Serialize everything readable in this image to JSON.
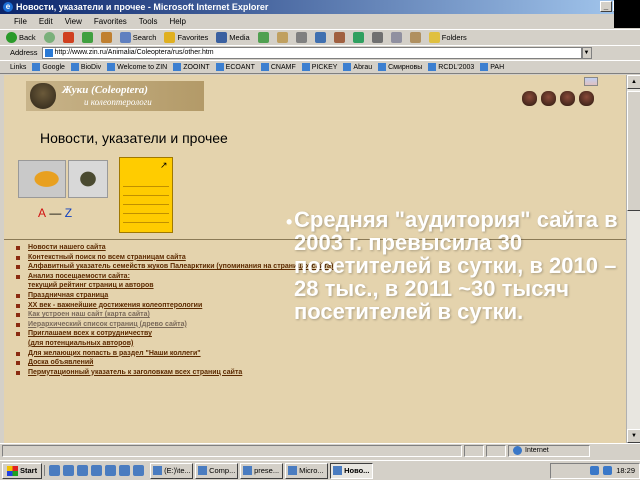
{
  "window": {
    "title": "Новости, указатели и прочее - Microsoft Internet Explorer",
    "controls": [
      "_",
      "□",
      "×"
    ]
  },
  "menu": [
    "File",
    "Edit",
    "View",
    "Favorites",
    "Tools",
    "Help"
  ],
  "toolbar": {
    "back": "Back",
    "search": "Search",
    "favorites": "Favorites",
    "media": "Media",
    "folders": "Folders"
  },
  "address": {
    "label": "Address",
    "url": "http://www.zin.ru/Animalia/Coleoptera/rus/other.htm"
  },
  "links": {
    "label": "Links",
    "items": [
      "Google",
      "BioDiv",
      "Welcome to ZIN",
      "ZOOINT",
      "ECOANT",
      "CNAMF",
      "PICKEY",
      "Abrau",
      "Смирновы",
      "RCDL'2003",
      "PAH"
    ]
  },
  "site": {
    "title": "Жуки (Coleoptera)",
    "subtitle": "и колеоптерологи"
  },
  "page": {
    "heading": "Новости, указатели и прочее",
    "az_a": "А",
    "az_dash": "—",
    "az_z": "Z",
    "arrow": "↗"
  },
  "menu_items": [
    {
      "text": "Новости нашего сайта",
      "style": "normal"
    },
    {
      "text": "Контекстный поиск по всем страницам сайта",
      "style": "normal"
    },
    {
      "text": "Алфавитный указатель семейств жуков Палеарктики (упоминания на страницах сайта)",
      "style": "normal"
    },
    {
      "text": "Анализ посещаемости сайта:",
      "style": "normal"
    },
    {
      "text": "текущий рейтинг страниц и авторов",
      "style": "cont"
    },
    {
      "text": "Праздничная страница",
      "style": "normal"
    },
    {
      "text": "XX век - важнейшие достижения колеоптерологии",
      "style": "normal"
    },
    {
      "text": "Как устроен наш сайт (карта сайта)",
      "style": "grey"
    },
    {
      "text": "Иерархический список страниц (древо сайта)",
      "style": "grey"
    },
    {
      "text": "Приглашаем всех к сотрудничеству",
      "style": "normal"
    },
    {
      "text": "(для потенциальных авторов)",
      "style": "cont"
    },
    {
      "text": "Для желающих попасть в раздел \"Наши коллеги\"",
      "style": "normal"
    },
    {
      "text": "Доска объявлений",
      "style": "normal"
    },
    {
      "text": "Пермутационный указатель к заголовкам всех страниц сайта",
      "style": "normal"
    }
  ],
  "slide": {
    "bullet": "•",
    "text": "Средняя \"аудитория\" сайта в 2003 г. превысила 30 посетителей в сутки, в 2010 – 28 тыс., в 2011 ~30 тысяч посетителей в сутки."
  },
  "status": {
    "zone": "Internet"
  },
  "taskbar": {
    "start": "Start",
    "tasks": [
      "(E:)\\te...",
      "Comp...",
      "prese...",
      "Micro...",
      "Ново..."
    ],
    "clock": "18:29"
  }
}
